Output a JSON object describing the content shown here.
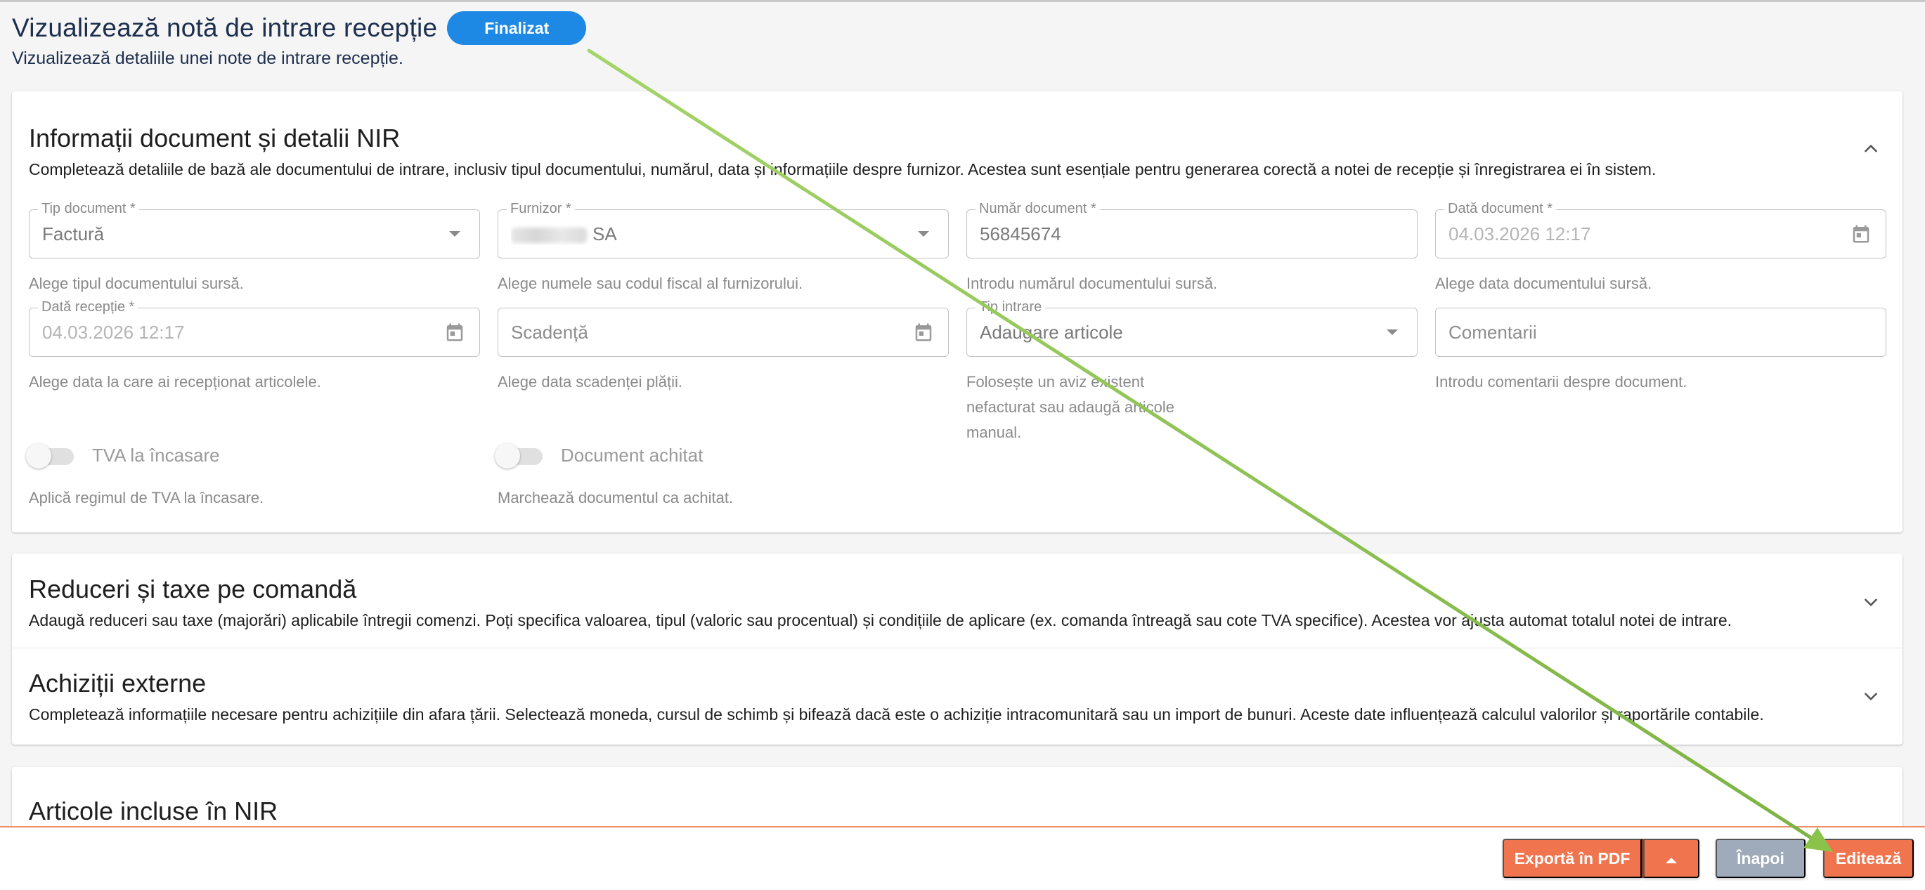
{
  "header": {
    "title": "Vizualizează notă de intrare recepție",
    "status": "Finalizat",
    "subtitle": "Vizualizează detaliile unei note de intrare recepție."
  },
  "section_document": {
    "title": "Informații document și detalii NIR",
    "description": "Completează detaliile de bază ale documentului de intrare, inclusiv tipul documentului, numărul, data și informațiile despre furnizor. Acestea sunt esențiale pentru generarea corectă a notei de recepție și înregistrarea ei în sistem.",
    "fields": {
      "doc_type": {
        "label": "Tip document *",
        "value": "Factură",
        "helper": "Alege tipul documentului sursă."
      },
      "supplier": {
        "label": "Furnizor *",
        "value": "SA",
        "helper": "Alege numele sau codul fiscal al furnizorului."
      },
      "doc_number": {
        "label": "Număr document *",
        "value": "56845674",
        "helper": "Introdu numărul documentului sursă."
      },
      "doc_date": {
        "label": "Dată document *",
        "value": "04.03.2026 12:17",
        "helper": "Alege data documentului sursă."
      },
      "reception_date": {
        "label": "Dată recepție *",
        "value": "04.03.2026 12:17",
        "helper": "Alege data la care ai recepționat articolele."
      },
      "due_date": {
        "placeholder": "Scadență",
        "helper": "Alege data scadenței plății."
      },
      "entry_type": {
        "label": "Tip intrare",
        "value": "Adaugare articole",
        "helper": "Folosește un aviz existent nefacturat sau adaugă articole manual."
      },
      "comments": {
        "placeholder": "Comentarii",
        "helper": "Introdu comentarii despre document."
      }
    },
    "toggles": {
      "vat_on_collection": {
        "label": "TVA la încasare",
        "helper": "Aplică regimul de TVA la încasare.",
        "checked": false
      },
      "document_paid": {
        "label": "Document achitat",
        "helper": "Marchează documentul ca achitat.",
        "checked": false
      }
    }
  },
  "section_discounts": {
    "title": "Reduceri și taxe pe comandă",
    "description": "Adaugă reduceri sau taxe (majorări) aplicabile întregii comenzi. Poți specifica valoarea, tipul (valoric sau procentual) și condițiile de aplicare (ex. comanda întreagă sau cote TVA specifice). Acestea vor ajusta automat totalul notei de intrare."
  },
  "section_external": {
    "title": "Achiziții externe",
    "description": "Completează informațiile necesare pentru achizițiile din afara țării. Selectează moneda, cursul de schimb și bifează dacă este o achiziție intracomunitară sau un import de bunuri. Aceste date influențează calculul valorilor și raportările contabile."
  },
  "section_items": {
    "title": "Articole incluse în NIR"
  },
  "actions": {
    "export_pdf": "Exportă în PDF",
    "back": "Înapoi",
    "edit": "Editează"
  },
  "colors": {
    "primary": "#1e88e5",
    "accent": "#f0754f",
    "neutral_button": "#9fabba",
    "annotation_arrow": "#8bc34a"
  }
}
